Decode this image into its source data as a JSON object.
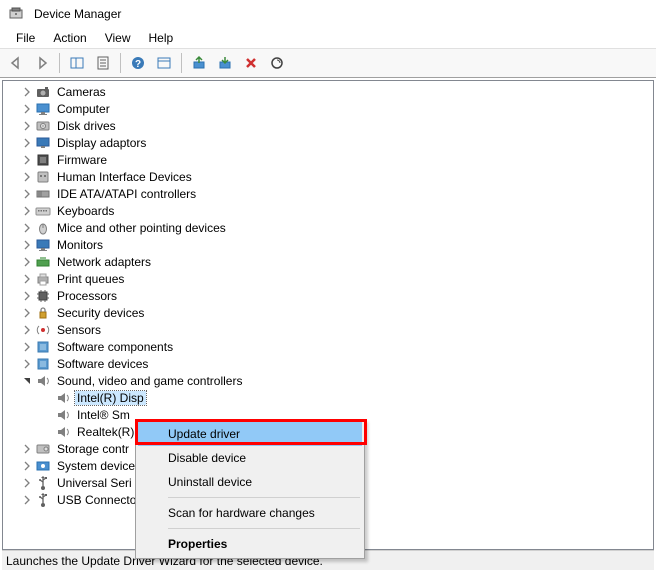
{
  "window": {
    "title": "Device Manager"
  },
  "menubar": {
    "items": [
      "File",
      "Action",
      "View",
      "Help"
    ]
  },
  "tree": {
    "categories": [
      {
        "label": "Cameras",
        "icon": "camera"
      },
      {
        "label": "Computer",
        "icon": "computer"
      },
      {
        "label": "Disk drives",
        "icon": "disk"
      },
      {
        "label": "Display adaptors",
        "icon": "display"
      },
      {
        "label": "Firmware",
        "icon": "firmware"
      },
      {
        "label": "Human Interface Devices",
        "icon": "hid"
      },
      {
        "label": "IDE ATA/ATAPI controllers",
        "icon": "ide"
      },
      {
        "label": "Keyboards",
        "icon": "keyboard"
      },
      {
        "label": "Mice and other pointing devices",
        "icon": "mouse"
      },
      {
        "label": "Monitors",
        "icon": "monitor"
      },
      {
        "label": "Network adapters",
        "icon": "network"
      },
      {
        "label": "Print queues",
        "icon": "printer"
      },
      {
        "label": "Processors",
        "icon": "processor"
      },
      {
        "label": "Security devices",
        "icon": "security"
      },
      {
        "label": "Sensors",
        "icon": "sensor"
      },
      {
        "label": "Software components",
        "icon": "software"
      },
      {
        "label": "Software devices",
        "icon": "software"
      }
    ],
    "expanded": {
      "label": "Sound, video and game controllers",
      "icon": "audio",
      "children": [
        {
          "label": "Intel(R) Display Audio",
          "truncated": "Intel(R) Disp",
          "selected": true
        },
        {
          "label": "Intel® Sm",
          "truncated": "Intel® Sm"
        },
        {
          "label": "Realtek(R)",
          "truncated": "Realtek(R)"
        }
      ]
    },
    "after": [
      {
        "label": "Storage contr",
        "icon": "storage"
      },
      {
        "label": "System device",
        "icon": "system"
      },
      {
        "label": "Universal Seri",
        "icon": "usb"
      },
      {
        "label": "USB Connecto",
        "icon": "usb"
      }
    ]
  },
  "contextMenu": {
    "items": [
      {
        "label": "Update driver",
        "highlight": true
      },
      {
        "label": "Disable device"
      },
      {
        "label": "Uninstall device"
      },
      {
        "sep": true
      },
      {
        "label": "Scan for hardware changes"
      },
      {
        "sep": true
      },
      {
        "label": "Properties",
        "bold": true
      }
    ]
  },
  "statusbar": {
    "text": "Launches the Update Driver Wizard for the selected device."
  }
}
